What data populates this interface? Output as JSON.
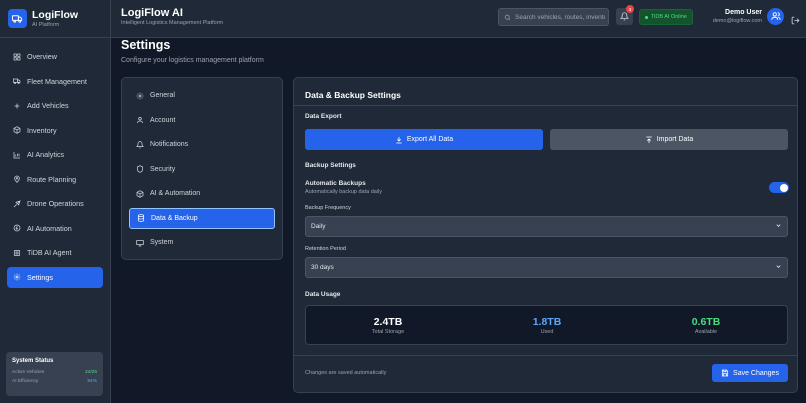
{
  "brand": {
    "name": "LogiFlow",
    "subtitle": "AI Platform"
  },
  "sidebar": {
    "items": [
      {
        "label": "Overview",
        "icon": "grid-icon"
      },
      {
        "label": "Fleet Management",
        "icon": "truck-icon"
      },
      {
        "label": "Add Vehicles",
        "icon": "plus-icon"
      },
      {
        "label": "Inventory",
        "icon": "box-icon"
      },
      {
        "label": "AI Analytics",
        "icon": "chart-icon"
      },
      {
        "label": "Route Planning",
        "icon": "map-pin-icon"
      },
      {
        "label": "Drone Operations",
        "icon": "drone-icon"
      },
      {
        "label": "AI Automation",
        "icon": "bolt-icon"
      },
      {
        "label": "TiDB AI Agent",
        "icon": "agent-icon"
      },
      {
        "label": "Settings",
        "icon": "gear-icon",
        "active": true
      }
    ],
    "status": {
      "title": "System Status",
      "rows": [
        {
          "label": "Active Vehicles",
          "value": "24/25"
        },
        {
          "label": "AI Efficiency",
          "value": "94%"
        }
      ]
    }
  },
  "header": {
    "title": "LogiFlow AI",
    "subtitle": "Intelligent Logistics Management Platform",
    "search_placeholder": "Search vehicles, routes, inventory...",
    "notification_count": "3",
    "online_label": "TiDB AI Online",
    "user_name": "Demo User",
    "user_email": "demo@logiflow.com"
  },
  "page": {
    "title": "Settings",
    "subtitle": "Configure your logistics management platform"
  },
  "settings_nav": [
    {
      "label": "General",
      "icon": "gear-icon"
    },
    {
      "label": "Account",
      "icon": "user-icon"
    },
    {
      "label": "Notifications",
      "icon": "bell-icon"
    },
    {
      "label": "Security",
      "icon": "shield-icon"
    },
    {
      "label": "AI & Automation",
      "icon": "cube-icon"
    },
    {
      "label": "Data & Backup",
      "icon": "database-icon",
      "active": true
    },
    {
      "label": "System",
      "icon": "monitor-icon"
    }
  ],
  "panel": {
    "title": "Data & Backup Settings",
    "data_export_label": "Data Export",
    "export_button": "Export All Data",
    "import_button": "Import Data",
    "backup_settings_label": "Backup Settings",
    "auto_backups_title": "Automatic Backups",
    "auto_backups_desc": "Automatically backup data daily",
    "auto_backups_enabled": true,
    "frequency_label": "Backup Frequency",
    "frequency_value": "Daily",
    "retention_label": "Retention Period",
    "retention_value": "30 days",
    "data_usage_label": "Data Usage",
    "usage": [
      {
        "value": "2.4TB",
        "label": "Total Storage",
        "color": "#ffffff"
      },
      {
        "value": "1.8TB",
        "label": "Used",
        "color": "#60a5fa"
      },
      {
        "value": "0.6TB",
        "label": "Available",
        "color": "#4ade80"
      }
    ],
    "autosave_note": "Changes are saved automatically",
    "save_button": "Save Changes"
  }
}
